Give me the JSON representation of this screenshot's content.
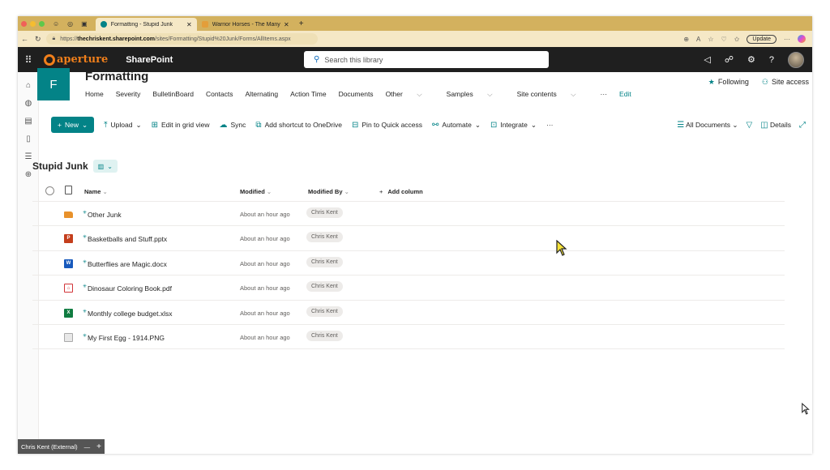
{
  "browser": {
    "tabs": [
      {
        "title": "Formatting - Stupid Junk",
        "active": true
      },
      {
        "title": "Warrior Horses - The Many-Ho",
        "active": false
      }
    ],
    "url_prefix": "https://",
    "url_host": "thechriskent.sharepoint.com",
    "url_path": "/sites/Formatting/Stupid%20Junk/Forms/AllItems.aspx",
    "update_label": "Update"
  },
  "suite": {
    "brand": "aperture",
    "app_name": "SharePoint",
    "search_placeholder": "Search this library"
  },
  "site": {
    "logo_letter": "F",
    "title": "Formatting",
    "nav": [
      "Home",
      "Severity",
      "BulletinBoard",
      "Contacts",
      "Alternating",
      "Action Time",
      "Documents",
      "Other",
      "Samples",
      "Site contents",
      "···",
      "Edit"
    ],
    "following_label": "Following",
    "site_access_label": "Site access"
  },
  "commands": {
    "new": "New",
    "upload": "Upload",
    "edit_grid": "Edit in grid view",
    "sync": "Sync",
    "add_shortcut": "Add shortcut to OneDrive",
    "pin": "Pin to Quick access",
    "automate": "Automate",
    "integrate": "Integrate",
    "more": "···",
    "view": "All Documents",
    "details": "Details"
  },
  "library": {
    "title": "Stupid Junk",
    "columns": {
      "name": "Name",
      "modified": "Modified",
      "modified_by": "Modified By",
      "add_column": "Add column"
    },
    "items": [
      {
        "name": "Other Junk",
        "type": "folder",
        "modified": "About an hour ago",
        "modified_by": "Chris Kent"
      },
      {
        "name": "Basketballs and Stuff.pptx",
        "type": "pptx",
        "modified": "About an hour ago",
        "modified_by": "Chris Kent"
      },
      {
        "name": "Butterflies are Magic.docx",
        "type": "docx",
        "modified": "About an hour ago",
        "modified_by": "Chris Kent"
      },
      {
        "name": "Dinosaur Coloring Book.pdf",
        "type": "pdf",
        "modified": "About an hour ago",
        "modified_by": "Chris Kent"
      },
      {
        "name": "Monthly college budget.xlsx",
        "type": "xlsx",
        "modified": "About an hour ago",
        "modified_by": "Chris Kent"
      },
      {
        "name": "My First Egg - 1914.PNG",
        "type": "png",
        "modified": "About an hour ago",
        "modified_by": "Chris Kent"
      }
    ]
  },
  "footer_tab": "Chris Kent (External)",
  "colors": {
    "accent": "#038387",
    "suite_bg": "#1f1f1f",
    "brand_orange": "#f07f1b",
    "tab_strip": "#d3b15e"
  }
}
